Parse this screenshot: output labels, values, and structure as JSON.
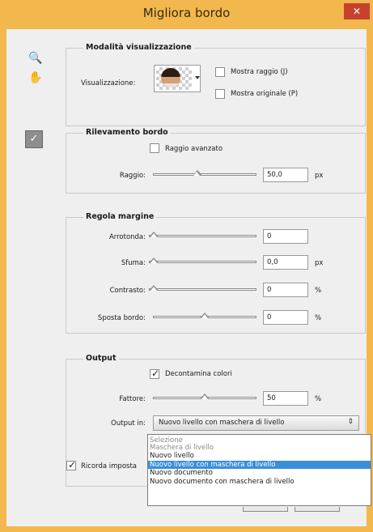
{
  "window": {
    "title": "Migliora bordo",
    "close_glyph": "✕"
  },
  "tools": {
    "zoom_glyph": "🔍",
    "hand_glyph": "✋",
    "brush_glyph": "✓"
  },
  "view_mode": {
    "title": "Modalità visualizzazione",
    "view_label": "Visualizzazione:",
    "show_radius": {
      "label": "Mostra raggio (J)",
      "checked": false
    },
    "show_original": {
      "label": "Mostra originale (P)",
      "checked": false
    }
  },
  "edge_detection": {
    "title": "Rilevamento bordo",
    "smart_radius": {
      "label": "Raggio avanzato",
      "checked": false
    },
    "radius": {
      "label": "Raggio:",
      "value": "50,0",
      "unit": "px",
      "level": 0.42
    }
  },
  "adjust_edge": {
    "title": "Regola margine",
    "smooth": {
      "label": "Arrotonda:",
      "value": "0",
      "unit": "",
      "level": 0.0
    },
    "feather": {
      "label": "Sfuma:",
      "value": "0,0",
      "unit": "px",
      "level": 0.0
    },
    "contrast": {
      "label": "Contrasto:",
      "value": "0",
      "unit": "%",
      "level": 0.0
    },
    "shift_edge": {
      "label": "Sposta bordo:",
      "value": "0",
      "unit": "%",
      "level": 0.5
    }
  },
  "output": {
    "title": "Output",
    "decontaminate": {
      "label": "Decontamina colori",
      "checked": true
    },
    "amount": {
      "label": "Fattore:",
      "value": "50",
      "unit": "%",
      "level": 0.5
    },
    "output_to": {
      "label": "Output in:",
      "selected": "Nuovo livello con maschera di livello",
      "arrow": "⇕"
    },
    "options": [
      {
        "label": "Selezione",
        "state": "disabled"
      },
      {
        "label": "Maschera di livello",
        "state": "disabled"
      },
      {
        "label": "Nuovo livello",
        "state": "normal"
      },
      {
        "label": "Nuovo livello con maschera di livello",
        "state": "selected"
      },
      {
        "label": "Nuovo documento",
        "state": "normal"
      },
      {
        "label": "Nuovo documento con maschera di livello",
        "state": "normal"
      }
    ]
  },
  "remember": {
    "label": "Ricorda imposta",
    "checked": true
  }
}
